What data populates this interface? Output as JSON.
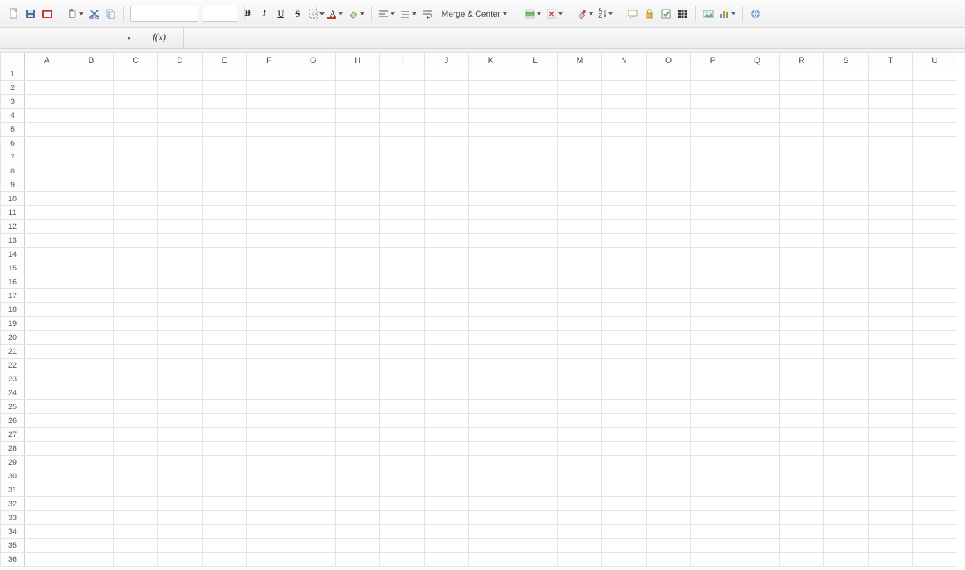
{
  "toolbar": {
    "font_name": "",
    "font_size": "",
    "bold_glyph": "B",
    "italic_glyph": "I",
    "underline_glyph": "U",
    "strike_glyph": "S",
    "font_color_glyph": "A",
    "merge_center_label": "Merge & Center",
    "sort_glyph": "A↓Z"
  },
  "formula_bar": {
    "cell_ref": "",
    "fx_label": "f(x)",
    "formula_value": ""
  },
  "grid": {
    "columns": [
      "A",
      "B",
      "C",
      "D",
      "E",
      "F",
      "G",
      "H",
      "I",
      "J",
      "K",
      "L",
      "M",
      "N",
      "O",
      "P",
      "Q",
      "R",
      "S",
      "T",
      "U"
    ],
    "row_start": 1,
    "row_end": 36,
    "cells": {}
  }
}
